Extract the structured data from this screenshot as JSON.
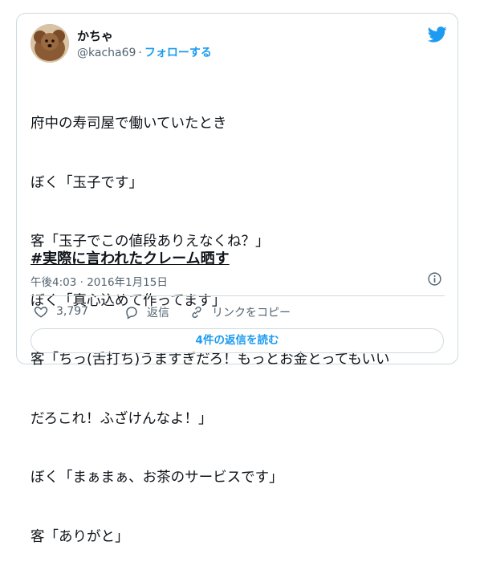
{
  "colors": {
    "accent": "#1d9bf0",
    "text": "#0f1419",
    "muted": "#536471",
    "border": "#cfd9de"
  },
  "user": {
    "name": "かちゃ",
    "handle": "@kacha69",
    "separator": "·",
    "follow_label": "フォローする"
  },
  "tweet": {
    "lines": [
      "府中の寿司屋で働いていたとき",
      "ぼく「玉子です」",
      "客「玉子でこの値段ありえなくね？」",
      "ぼく「真心込めて作ってます」",
      "客「ちっ(舌打ち)うますぎだろ！もっとお金とってもいい",
      "だろこれ！ふざけんなよ！」",
      "ぼく「まぁまぁ、お茶のサービスです」",
      "客「ありがと」"
    ],
    "hashtag": "#実際に言われたクレーム晒す",
    "timestamp": "午後4:03 · 2016年1月15日"
  },
  "actions": {
    "like_count": "3,797",
    "reply_label": "返信",
    "copy_link_label": "リンクをコピー"
  },
  "replies_button_label": "4件の返信を読む",
  "icons": [
    "twitter-bird-icon",
    "info-icon",
    "heart-icon",
    "reply-bubble-icon",
    "link-icon"
  ]
}
